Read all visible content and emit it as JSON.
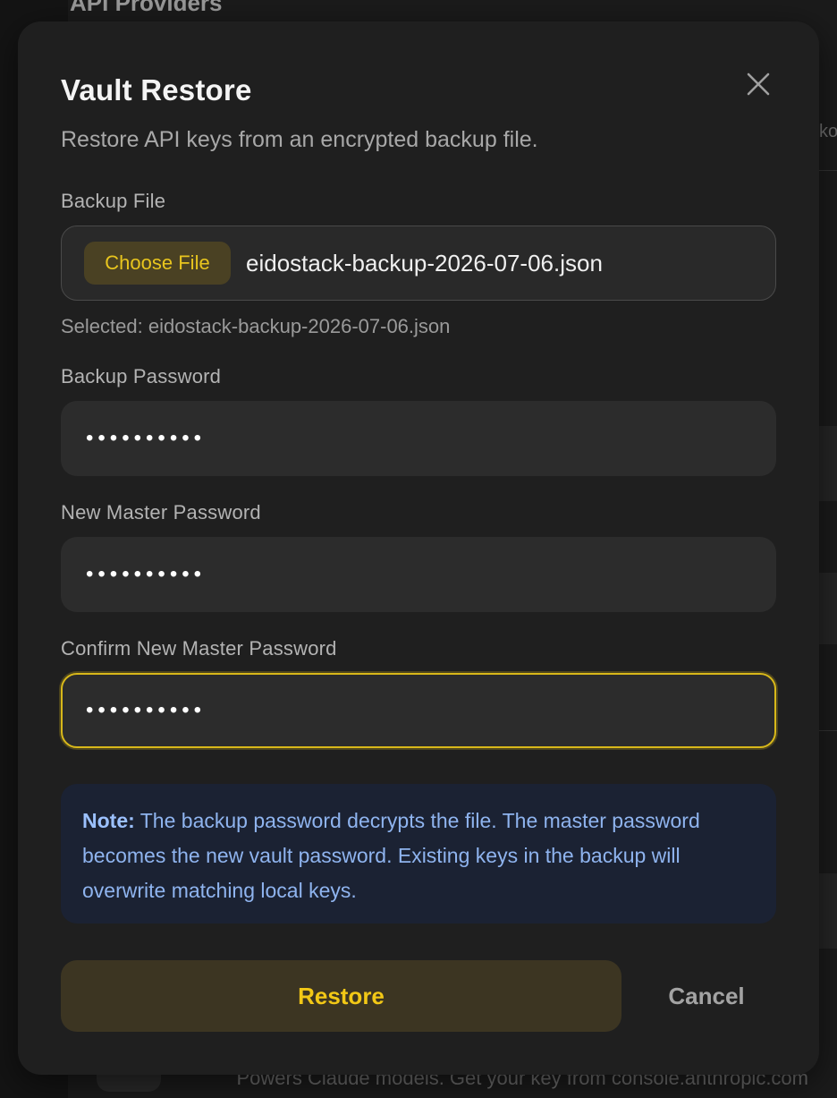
{
  "background": {
    "page_title": "API Providers",
    "row_description": "Powers Claude models. Get your key from console.anthropic.com",
    "edge_text": "ko"
  },
  "modal": {
    "title": "Vault Restore",
    "description": "Restore API keys from an encrypted backup file.",
    "close_icon": "close-icon",
    "backup_file": {
      "label": "Backup File",
      "button_label": "Choose File",
      "file_name": "eidostack-backup-2026-07-06.json",
      "selected_text": "Selected: eidostack-backup-2026-07-06.json"
    },
    "backup_password": {
      "label": "Backup Password",
      "masked_value": "••••••••••"
    },
    "new_master_password": {
      "label": "New Master Password",
      "masked_value": "••••••••••"
    },
    "confirm_master_password": {
      "label": "Confirm New Master Password",
      "masked_value": "••••••••••",
      "focused": true
    },
    "note": {
      "strong": "Note:",
      "text": " The backup password decrypts the file. The master password becomes the new vault password. Existing keys in the backup will overwrite matching local keys."
    },
    "actions": {
      "restore_label": "Restore",
      "cancel_label": "Cancel"
    }
  },
  "colors": {
    "accent": "#e8c51e",
    "note_text": "#8fb4ef",
    "note_bg": "#1b2233",
    "modal_bg": "#1f1f1f"
  }
}
